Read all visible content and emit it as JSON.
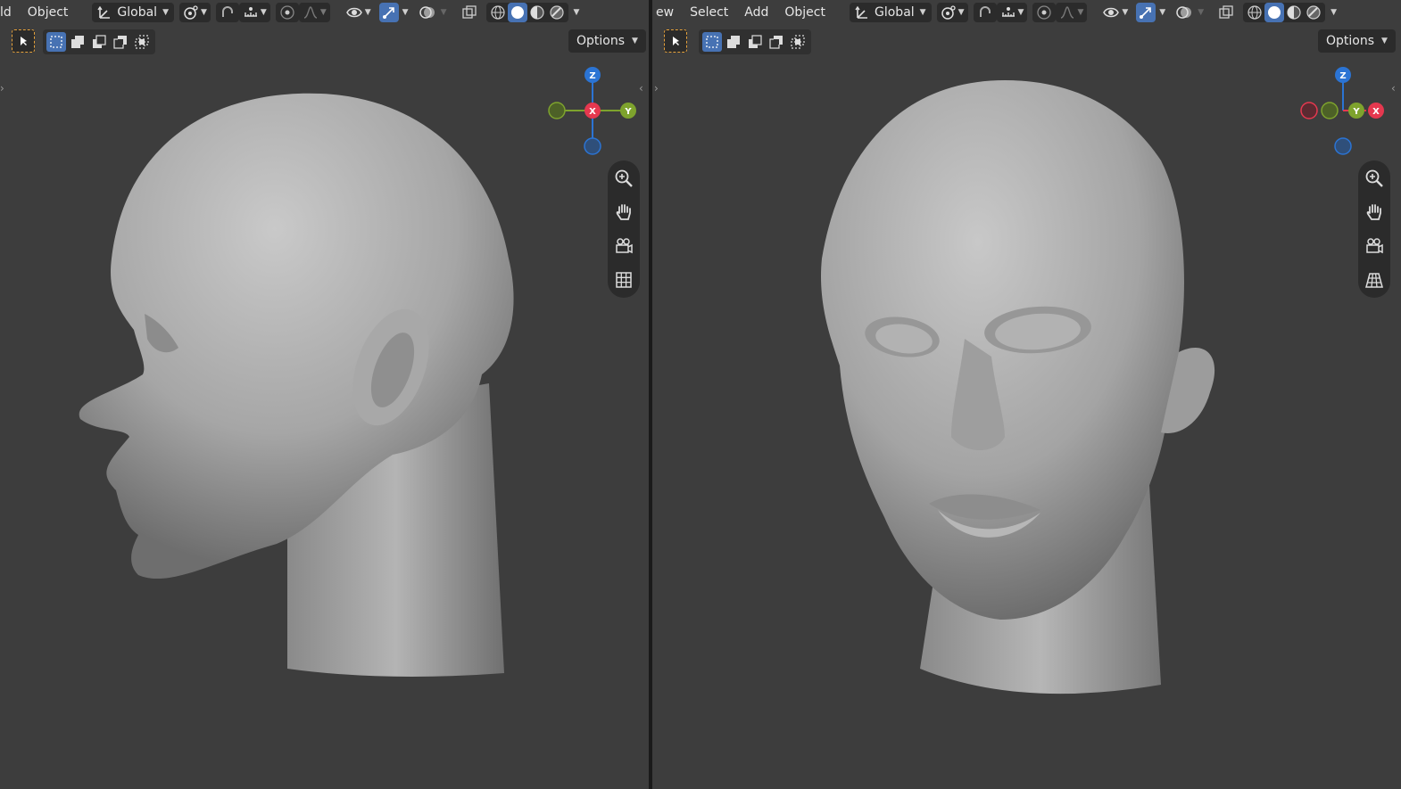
{
  "left_viewport": {
    "menu": {
      "clipped": "ld",
      "object": "Object"
    },
    "transform_orientation": "Global",
    "options_label": "Options",
    "gizmo_labels": {
      "z": "Z",
      "x": "X",
      "y": "Y"
    }
  },
  "right_viewport": {
    "menu": {
      "clipped": "ew",
      "select": "Select",
      "add": "Add",
      "object": "Object"
    },
    "transform_orientation": "Global",
    "options_label": "Options",
    "gizmo_labels": {
      "z": "Z",
      "y": "Y",
      "x": "X"
    }
  },
  "colors": {
    "viewport_bg": "#3d3d3d",
    "header_button_bg": "#2b2b2b",
    "active_blue": "#4772b3",
    "axis_x": "#e5384f",
    "axis_y": "#7ea32d",
    "axis_z": "#2b74d4",
    "select_tool_outline": "#e6a23c"
  }
}
